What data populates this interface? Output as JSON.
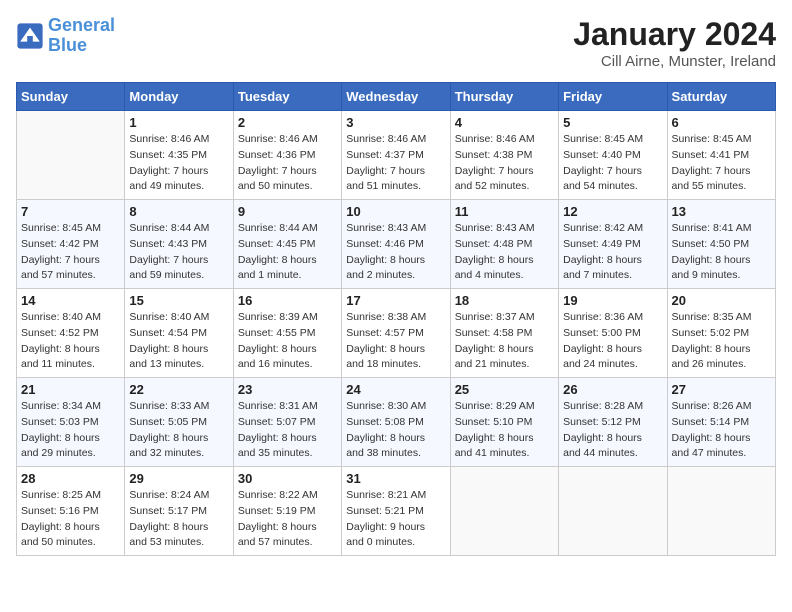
{
  "header": {
    "logo_line1": "General",
    "logo_line2": "Blue",
    "title": "January 2024",
    "subtitle": "Cill Airne, Munster, Ireland"
  },
  "columns": [
    "Sunday",
    "Monday",
    "Tuesday",
    "Wednesday",
    "Thursday",
    "Friday",
    "Saturday"
  ],
  "weeks": [
    [
      {
        "day": "",
        "detail": ""
      },
      {
        "day": "1",
        "detail": "Sunrise: 8:46 AM\nSunset: 4:35 PM\nDaylight: 7 hours\nand 49 minutes."
      },
      {
        "day": "2",
        "detail": "Sunrise: 8:46 AM\nSunset: 4:36 PM\nDaylight: 7 hours\nand 50 minutes."
      },
      {
        "day": "3",
        "detail": "Sunrise: 8:46 AM\nSunset: 4:37 PM\nDaylight: 7 hours\nand 51 minutes."
      },
      {
        "day": "4",
        "detail": "Sunrise: 8:46 AM\nSunset: 4:38 PM\nDaylight: 7 hours\nand 52 minutes."
      },
      {
        "day": "5",
        "detail": "Sunrise: 8:45 AM\nSunset: 4:40 PM\nDaylight: 7 hours\nand 54 minutes."
      },
      {
        "day": "6",
        "detail": "Sunrise: 8:45 AM\nSunset: 4:41 PM\nDaylight: 7 hours\nand 55 minutes."
      }
    ],
    [
      {
        "day": "7",
        "detail": "Sunrise: 8:45 AM\nSunset: 4:42 PM\nDaylight: 7 hours\nand 57 minutes."
      },
      {
        "day": "8",
        "detail": "Sunrise: 8:44 AM\nSunset: 4:43 PM\nDaylight: 7 hours\nand 59 minutes."
      },
      {
        "day": "9",
        "detail": "Sunrise: 8:44 AM\nSunset: 4:45 PM\nDaylight: 8 hours\nand 1 minute."
      },
      {
        "day": "10",
        "detail": "Sunrise: 8:43 AM\nSunset: 4:46 PM\nDaylight: 8 hours\nand 2 minutes."
      },
      {
        "day": "11",
        "detail": "Sunrise: 8:43 AM\nSunset: 4:48 PM\nDaylight: 8 hours\nand 4 minutes."
      },
      {
        "day": "12",
        "detail": "Sunrise: 8:42 AM\nSunset: 4:49 PM\nDaylight: 8 hours\nand 7 minutes."
      },
      {
        "day": "13",
        "detail": "Sunrise: 8:41 AM\nSunset: 4:50 PM\nDaylight: 8 hours\nand 9 minutes."
      }
    ],
    [
      {
        "day": "14",
        "detail": "Sunrise: 8:40 AM\nSunset: 4:52 PM\nDaylight: 8 hours\nand 11 minutes."
      },
      {
        "day": "15",
        "detail": "Sunrise: 8:40 AM\nSunset: 4:54 PM\nDaylight: 8 hours\nand 13 minutes."
      },
      {
        "day": "16",
        "detail": "Sunrise: 8:39 AM\nSunset: 4:55 PM\nDaylight: 8 hours\nand 16 minutes."
      },
      {
        "day": "17",
        "detail": "Sunrise: 8:38 AM\nSunset: 4:57 PM\nDaylight: 8 hours\nand 18 minutes."
      },
      {
        "day": "18",
        "detail": "Sunrise: 8:37 AM\nSunset: 4:58 PM\nDaylight: 8 hours\nand 21 minutes."
      },
      {
        "day": "19",
        "detail": "Sunrise: 8:36 AM\nSunset: 5:00 PM\nDaylight: 8 hours\nand 24 minutes."
      },
      {
        "day": "20",
        "detail": "Sunrise: 8:35 AM\nSunset: 5:02 PM\nDaylight: 8 hours\nand 26 minutes."
      }
    ],
    [
      {
        "day": "21",
        "detail": "Sunrise: 8:34 AM\nSunset: 5:03 PM\nDaylight: 8 hours\nand 29 minutes."
      },
      {
        "day": "22",
        "detail": "Sunrise: 8:33 AM\nSunset: 5:05 PM\nDaylight: 8 hours\nand 32 minutes."
      },
      {
        "day": "23",
        "detail": "Sunrise: 8:31 AM\nSunset: 5:07 PM\nDaylight: 8 hours\nand 35 minutes."
      },
      {
        "day": "24",
        "detail": "Sunrise: 8:30 AM\nSunset: 5:08 PM\nDaylight: 8 hours\nand 38 minutes."
      },
      {
        "day": "25",
        "detail": "Sunrise: 8:29 AM\nSunset: 5:10 PM\nDaylight: 8 hours\nand 41 minutes."
      },
      {
        "day": "26",
        "detail": "Sunrise: 8:28 AM\nSunset: 5:12 PM\nDaylight: 8 hours\nand 44 minutes."
      },
      {
        "day": "27",
        "detail": "Sunrise: 8:26 AM\nSunset: 5:14 PM\nDaylight: 8 hours\nand 47 minutes."
      }
    ],
    [
      {
        "day": "28",
        "detail": "Sunrise: 8:25 AM\nSunset: 5:16 PM\nDaylight: 8 hours\nand 50 minutes."
      },
      {
        "day": "29",
        "detail": "Sunrise: 8:24 AM\nSunset: 5:17 PM\nDaylight: 8 hours\nand 53 minutes."
      },
      {
        "day": "30",
        "detail": "Sunrise: 8:22 AM\nSunset: 5:19 PM\nDaylight: 8 hours\nand 57 minutes."
      },
      {
        "day": "31",
        "detail": "Sunrise: 8:21 AM\nSunset: 5:21 PM\nDaylight: 9 hours\nand 0 minutes."
      },
      {
        "day": "",
        "detail": ""
      },
      {
        "day": "",
        "detail": ""
      },
      {
        "day": "",
        "detail": ""
      }
    ]
  ]
}
